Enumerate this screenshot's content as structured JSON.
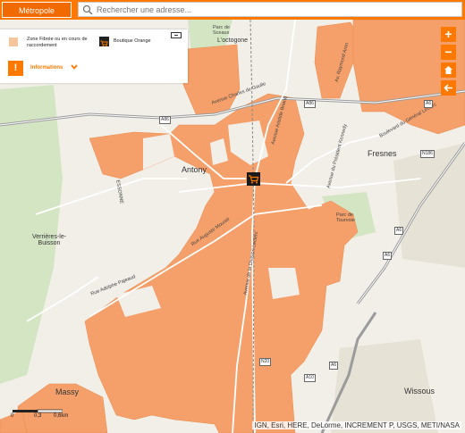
{
  "header": {
    "metropole_label": "Métropole",
    "search_placeholder": "Rechercher une adresse..."
  },
  "legend": {
    "zone_label": "Zone Fibrée ou en cours de raccordement",
    "boutique_label": "Boutique Orange",
    "info_label": "Informations",
    "info_icon": "!"
  },
  "controls": {
    "zoom_in": "+",
    "zoom_out": "−"
  },
  "map": {
    "attribution": "IGN, Esri, HERE, DeLorme, INCREMENT P, USGS, METI/NASA",
    "places": {
      "antony": "Antony",
      "fresnes": "Fresnes",
      "verrieres": "Verrières-le-Buisson",
      "massy": "Massy",
      "wissous": "Wissous",
      "octogone": "L'octogone",
      "parc_sceaux": "Parc de Sceaux",
      "parc_tourvoie": "Parc de Tourvoie",
      "essonne": "ESSONNE"
    },
    "streets": {
      "gaulle": "Avenue Charles de Gaulle",
      "lecler": "Boulevard du Général Leclerc",
      "president_kennedy": "Avenue du Président Kennedy",
      "aristide": "Avenue Aristide Briand",
      "division": "Avenue de la Division Leclerc",
      "raymond": "Av. Raymond Aron",
      "pajeaud": "Rue Adolphe Pajeaud",
      "mounie": "Rue Auguste Mounié"
    },
    "roads": [
      "A86",
      "A86",
      "N20",
      "A6",
      "A6",
      "A6",
      "A10",
      "N186",
      "A6"
    ],
    "scale": [
      "0",
      "0,3",
      "0,6km"
    ],
    "colors": {
      "fibre_zone": "#f5a06a",
      "brand": "#ff7900"
    }
  }
}
